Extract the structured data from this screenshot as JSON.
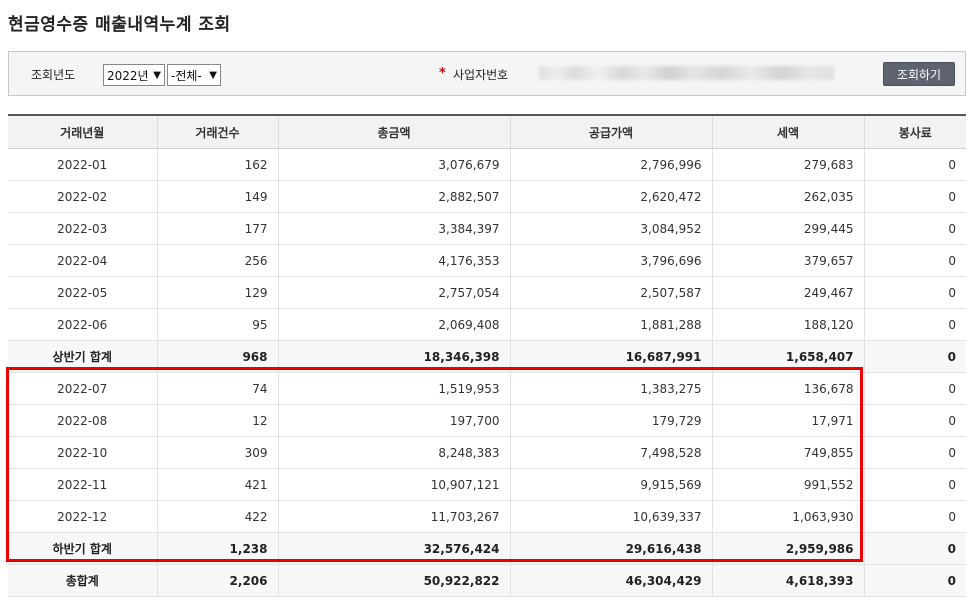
{
  "page": {
    "title": "현금영수증 매출내역누계 조회"
  },
  "search": {
    "year_label": "조회년도",
    "year_value": "2022년",
    "period_value": "-전체-",
    "required_mark": "*",
    "biz_no_label": "사업자번호",
    "search_button": "조회하기"
  },
  "table": {
    "headers": [
      "거래년월",
      "거래건수",
      "총금액",
      "공급가액",
      "세액",
      "봉사료"
    ],
    "rows": [
      [
        "2022-01",
        "162",
        "3,076,679",
        "2,796,996",
        "279,683",
        "0"
      ],
      [
        "2022-02",
        "149",
        "2,882,507",
        "2,620,472",
        "262,035",
        "0"
      ],
      [
        "2022-03",
        "177",
        "3,384,397",
        "3,084,952",
        "299,445",
        "0"
      ],
      [
        "2022-04",
        "256",
        "4,176,353",
        "3,796,696",
        "379,657",
        "0"
      ],
      [
        "2022-05",
        "129",
        "2,757,054",
        "2,507,587",
        "249,467",
        "0"
      ],
      [
        "2022-06",
        "95",
        "2,069,408",
        "1,881,288",
        "188,120",
        "0"
      ],
      [
        "상반기 합계",
        "968",
        "18,346,398",
        "16,687,991",
        "1,658,407",
        "0"
      ],
      [
        "2022-07",
        "74",
        "1,519,953",
        "1,383,275",
        "136,678",
        "0"
      ],
      [
        "2022-08",
        "12",
        "197,700",
        "179,729",
        "17,971",
        "0"
      ],
      [
        "2022-10",
        "309",
        "8,248,383",
        "7,498,528",
        "749,855",
        "0"
      ],
      [
        "2022-11",
        "421",
        "10,907,121",
        "9,915,569",
        "991,552",
        "0"
      ],
      [
        "2022-12",
        "422",
        "11,703,267",
        "10,639,337",
        "1,063,930",
        "0"
      ],
      [
        "하반기 합계",
        "1,238",
        "32,576,424",
        "29,616,438",
        "2,959,986",
        "0"
      ],
      [
        "총합계",
        "2,206",
        "50,922,822",
        "46,304,429",
        "4,618,393",
        "0"
      ]
    ]
  },
  "colors": {
    "highlight": "#ee0000",
    "button_bg": "#5d6470"
  }
}
